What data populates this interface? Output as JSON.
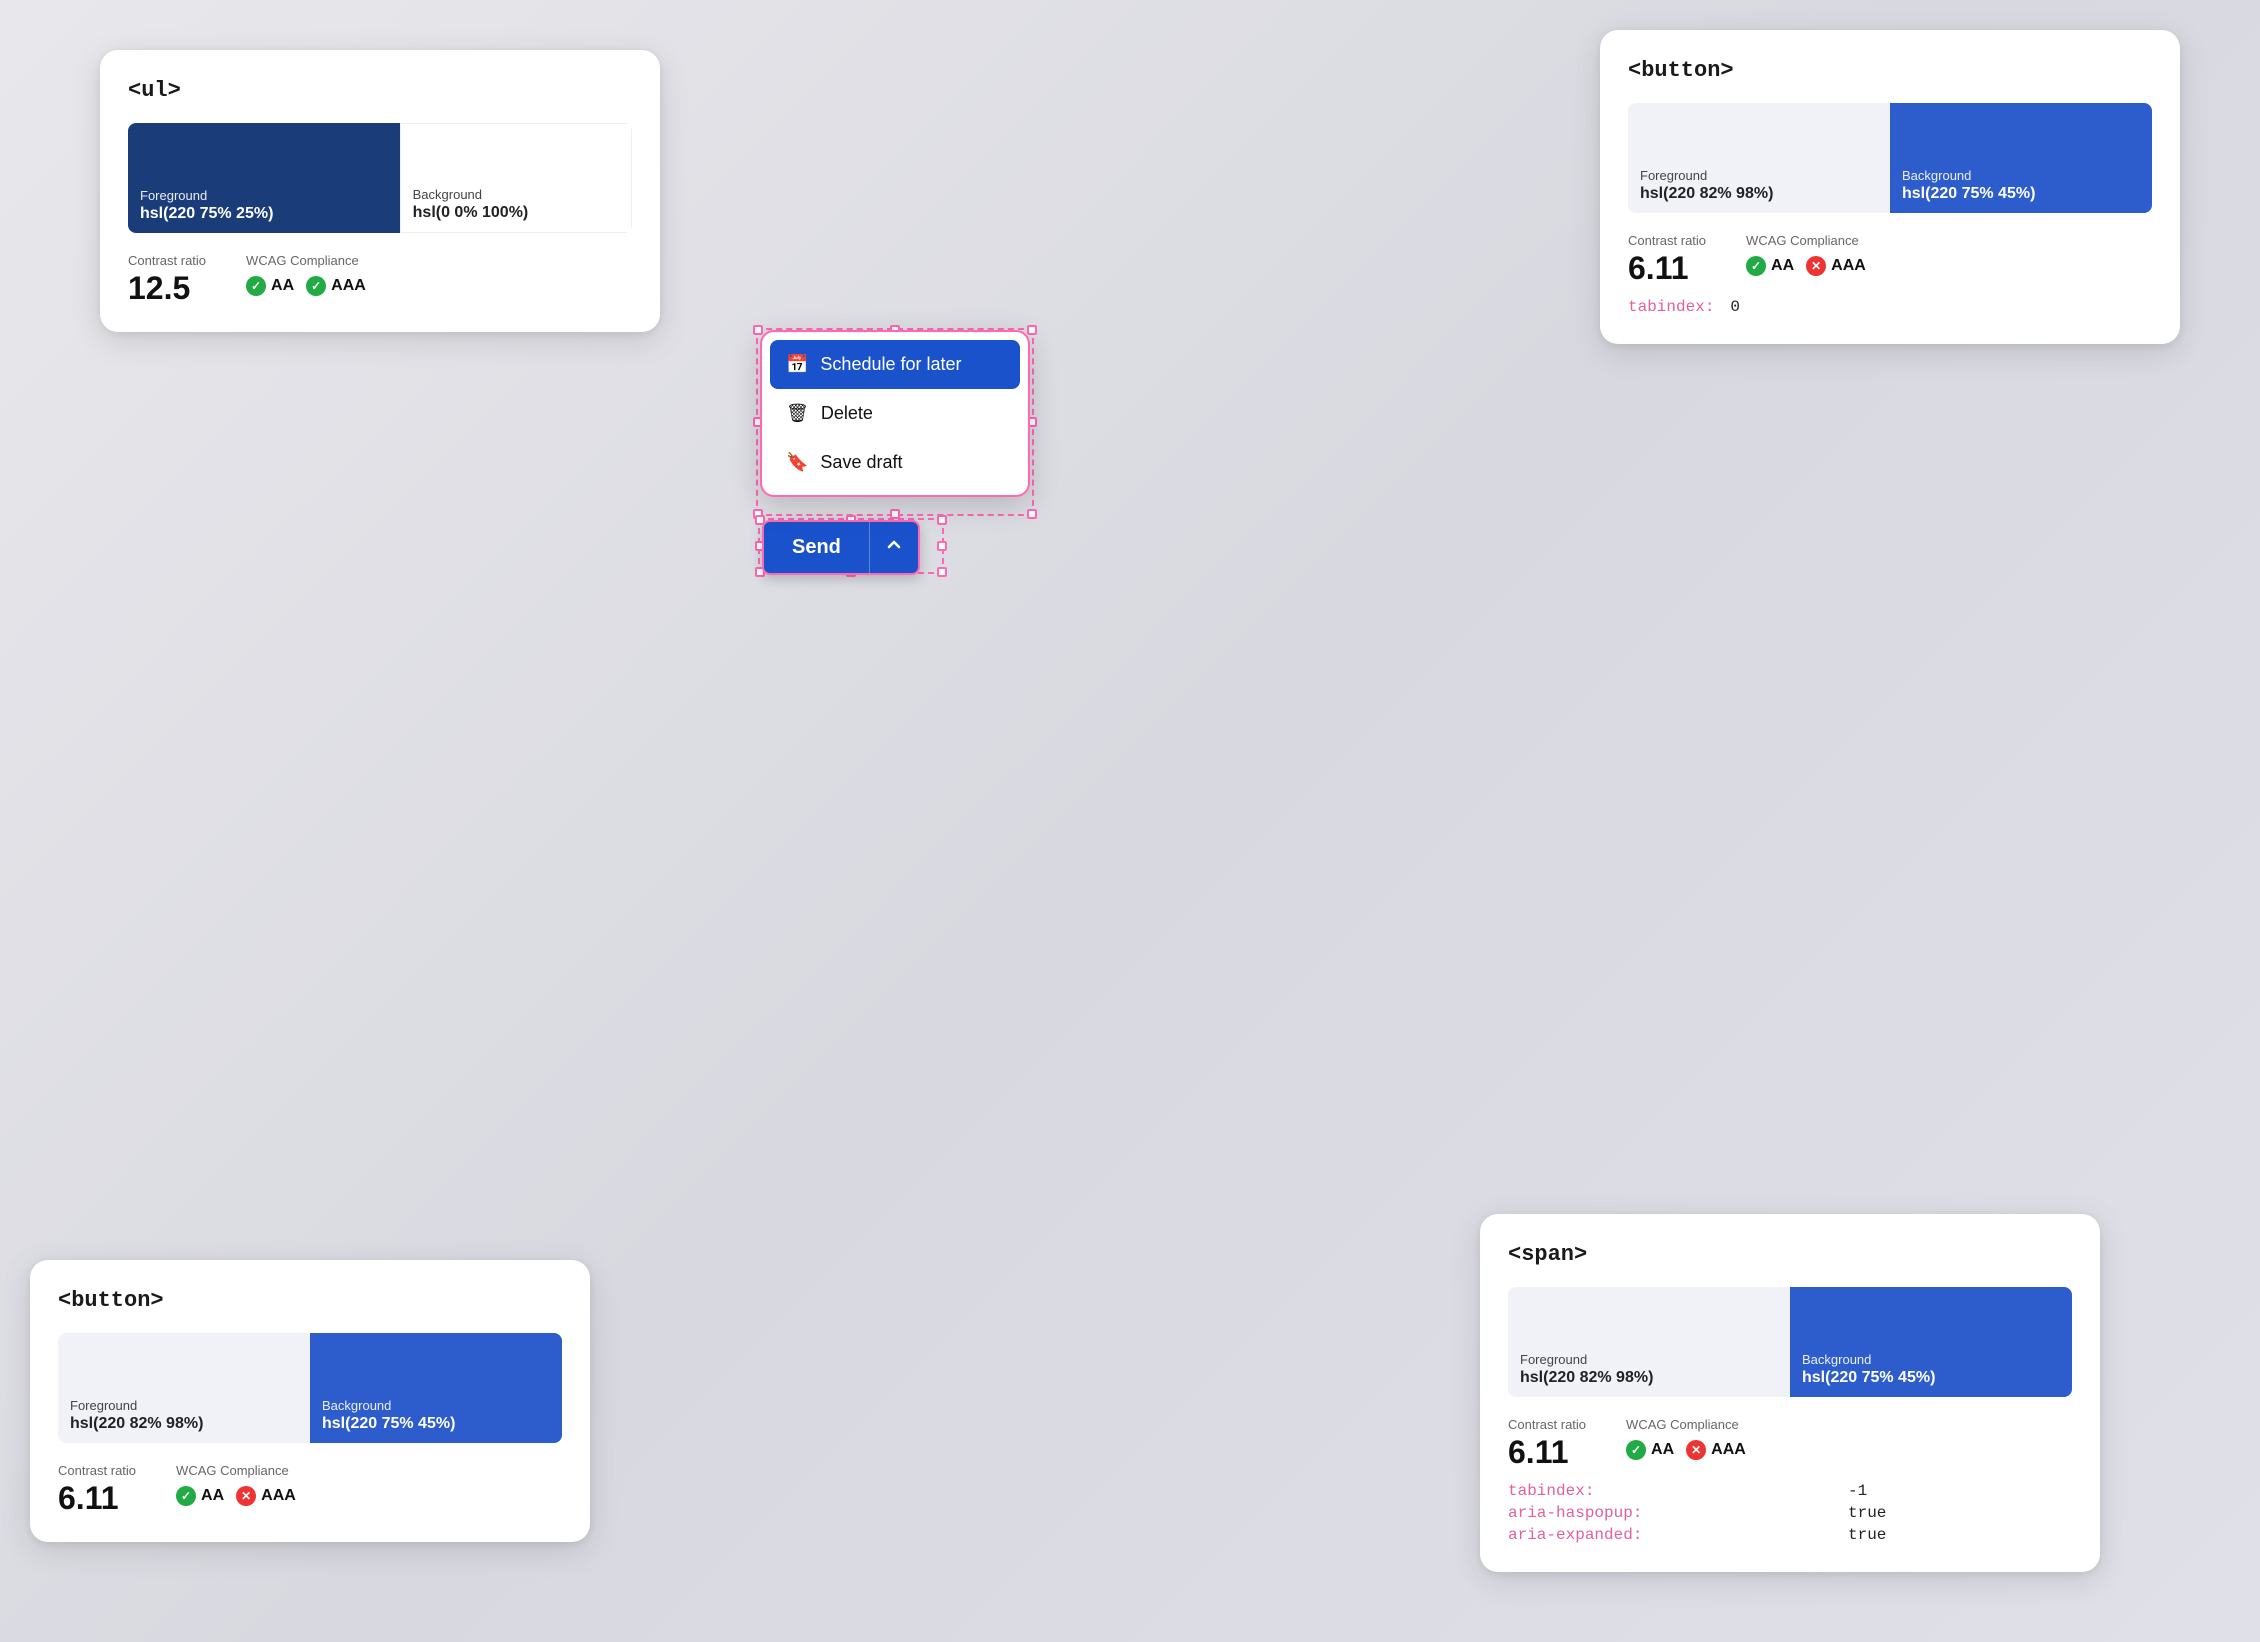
{
  "cards": {
    "ul": {
      "title": "<ul>",
      "foreground_label": "Foreground",
      "foreground_value": "hsl(220 75% 25%)",
      "background_label": "Background",
      "background_value": "hsl(0 0% 100%)",
      "contrast_label": "Contrast ratio",
      "contrast_value": "12.5",
      "wcag_label": "WCAG Compliance",
      "aa_label": "AA",
      "aaa_label": "AAA"
    },
    "button_top": {
      "title": "<button>",
      "foreground_label": "Foreground",
      "foreground_value": "hsl(220 82% 98%)",
      "background_label": "Background",
      "background_value": "hsl(220 75% 45%)",
      "contrast_label": "Contrast ratio",
      "contrast_value": "6.11",
      "wcag_label": "WCAG Compliance",
      "aa_label": "AA",
      "aaa_label": "AAA",
      "tabindex_label": "tabindex:",
      "tabindex_value": "0"
    },
    "button_bottom": {
      "title": "<button>",
      "foreground_label": "Foreground",
      "foreground_value": "hsl(220 82% 98%)",
      "background_label": "Background",
      "background_value": "hsl(220 75% 45%)",
      "contrast_label": "Contrast ratio",
      "contrast_value": "6.11",
      "wcag_label": "WCAG Compliance",
      "aa_label": "AA",
      "aaa_label": "AAA"
    },
    "span": {
      "title": "<span>",
      "foreground_label": "Foreground",
      "foreground_value": "hsl(220 82% 98%)",
      "background_label": "Background",
      "background_value": "hsl(220 75% 45%)",
      "contrast_label": "Contrast ratio",
      "contrast_value": "6.11",
      "wcag_label": "WCAG Compliance",
      "aa_label": "AA",
      "aaa_label": "AAA",
      "tabindex_label": "tabindex:",
      "tabindex_value": "-1",
      "aria_haspopup_label": "aria-haspopup:",
      "aria_haspopup_value": "true",
      "aria_expanded_label": "aria-expanded:",
      "aria_expanded_value": "true"
    }
  },
  "dropdown": {
    "schedule_label": "Schedule for later",
    "delete_label": "Delete",
    "save_draft_label": "Save draft"
  },
  "send_button": {
    "label": "Send",
    "chevron": "^"
  },
  "colors": {
    "blue_dark": "#1a3d7a",
    "blue_mid": "#2d5ccc",
    "blue_light_bg": "#f0f2f8",
    "pink_selection": "#ff69b4",
    "green_pass": "#22aa44",
    "red_fail": "#ee3333",
    "attr_pink": "#e060a0"
  }
}
